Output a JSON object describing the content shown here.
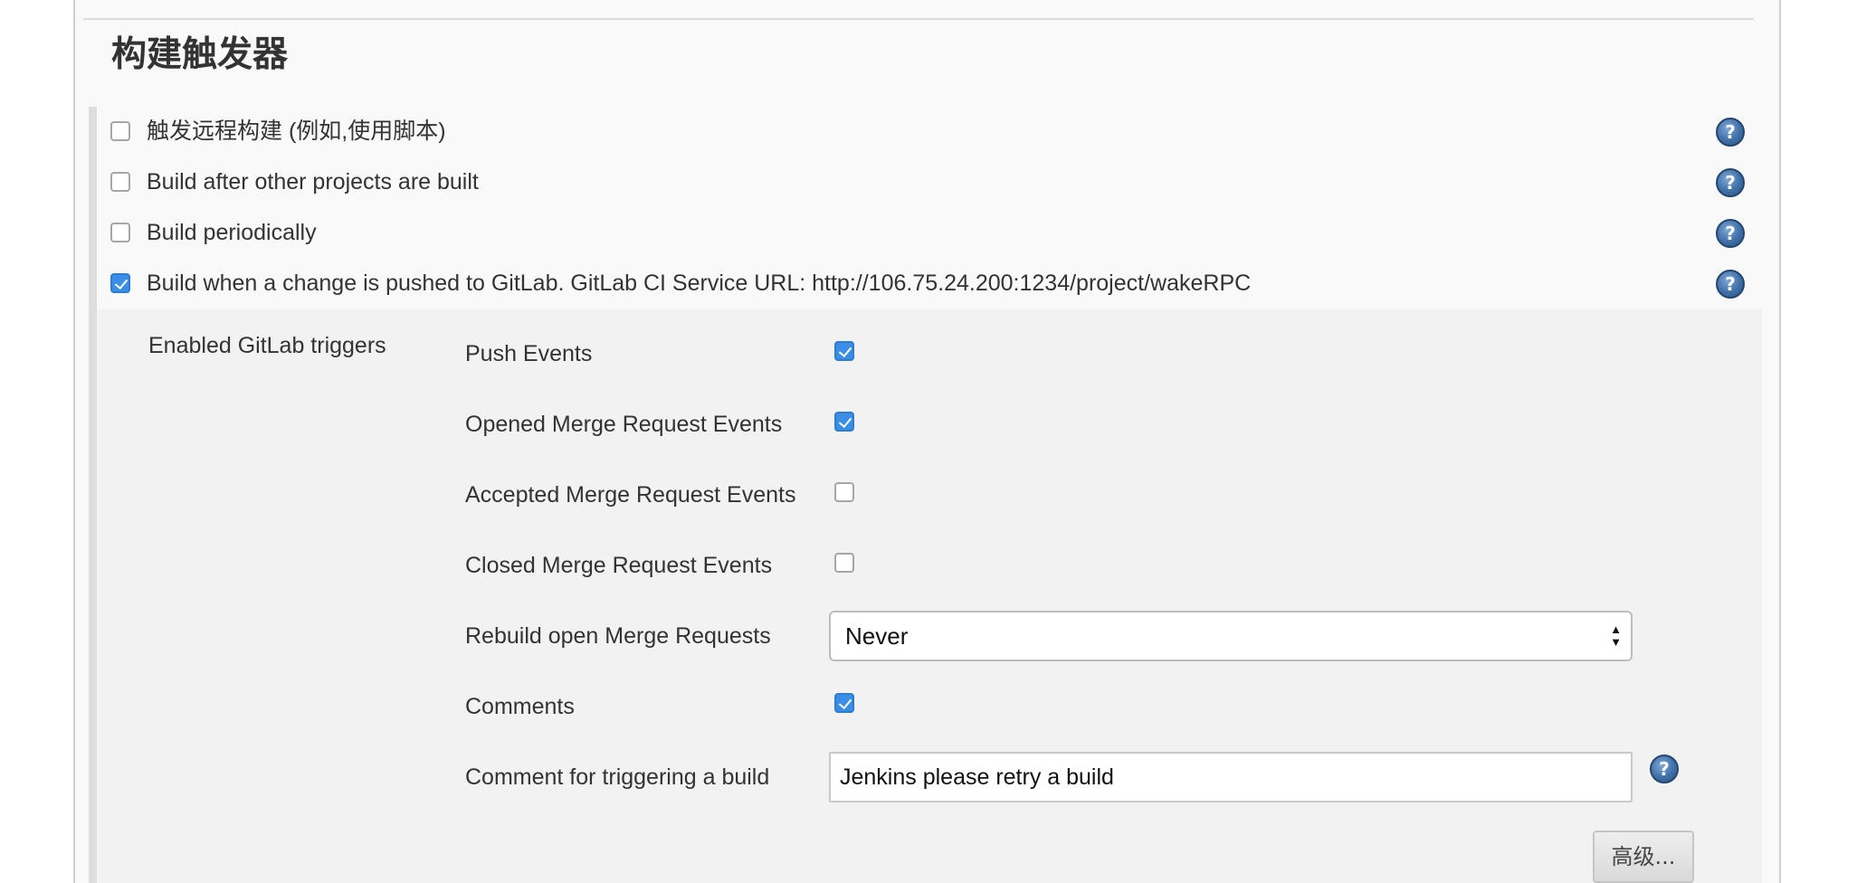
{
  "section": {
    "title": "构建触发器"
  },
  "triggers": [
    {
      "label": "触发远程构建 (例如,使用脚本)",
      "checked": false
    },
    {
      "label": "Build after other projects are built",
      "checked": false
    },
    {
      "label": "Build periodically",
      "checked": false
    },
    {
      "label": "Build when a change is pushed to GitLab. GitLab CI Service URL: http://106.75.24.200:1234/project/wakeRPC",
      "checked": true
    }
  ],
  "help_icon": {
    "name": "help-icon",
    "glyph": "?"
  },
  "gitlab": {
    "enabled_label": "Enabled GitLab triggers",
    "options": [
      {
        "label": "Push Events",
        "checked": true
      },
      {
        "label": "Opened Merge Request Events",
        "checked": true
      },
      {
        "label": "Accepted Merge Request Events",
        "checked": false
      },
      {
        "label": "Closed Merge Request Events",
        "checked": false
      }
    ],
    "rebuild": {
      "label": "Rebuild open Merge Requests",
      "value": "Never"
    },
    "comments": {
      "label": "Comments",
      "checked": true
    },
    "comment_trigger": {
      "label": "Comment for triggering a build",
      "value": "Jenkins please retry a build"
    },
    "advanced_button": "高级..."
  },
  "colors": {
    "checkbox_checked": "#3a8ee6",
    "help_icon": "#3f6fa8",
    "panel_bg": "#f2f2f2"
  }
}
